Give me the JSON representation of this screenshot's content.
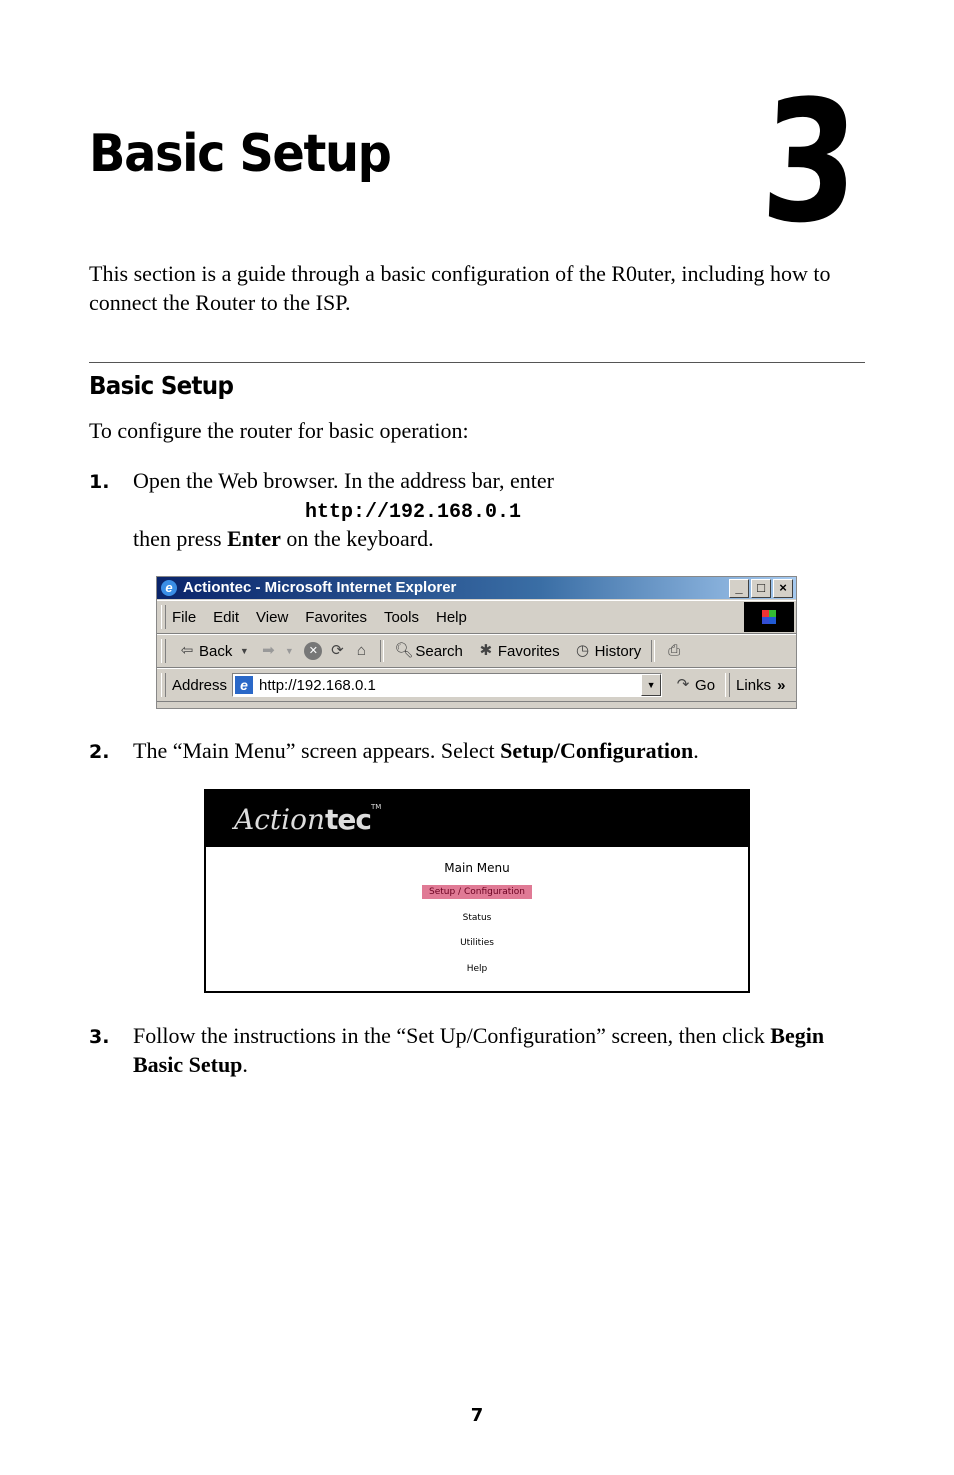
{
  "chapter": {
    "title": "Basic Setup",
    "number": "3"
  },
  "intro": "This section is a guide through a basic configuration of the R0uter, including how to connect the Router to the ISP.",
  "section": {
    "heading": "Basic Setup",
    "lead": "To configure the router for basic operation:",
    "steps": [
      {
        "num": "1.",
        "text_a": "Open the Web browser. In the address bar, enter",
        "code": "http://192.168.0.1",
        "text_b_pre": "then press ",
        "text_b_bold": "Enter",
        "text_b_post": " on the keyboard."
      },
      {
        "num": "2.",
        "text_pre": "The “Main Menu” screen appears. Select ",
        "text_bold": "Setup/Configuration",
        "text_post": "."
      },
      {
        "num": "3.",
        "text_pre": "Follow the instructions in the “Set Up/Configuration” screen, then click ",
        "text_bold": "Begin Basic Setup",
        "text_post": "."
      }
    ]
  },
  "browser": {
    "title": "Actiontec - Microsoft Internet Explorer",
    "window_buttons": [
      "_",
      "□",
      "×"
    ],
    "menu": [
      "File",
      "Edit",
      "View",
      "Favorites",
      "Tools",
      "Help"
    ],
    "toolbar": {
      "back": "Back",
      "search": "Search",
      "favorites": "Favorites",
      "history": "History"
    },
    "address_label": "Address",
    "address_value": "http://192.168.0.1",
    "go": "Go",
    "links": "Links",
    "links_more": "»"
  },
  "router_screen": {
    "logo_script": "Action",
    "logo_tec": "tec",
    "logo_tm": "TM",
    "title": "Main Menu",
    "items": [
      "Setup / Configuration",
      "Status",
      "Utilities",
      "Help"
    ],
    "selected_color": "#e07a95"
  },
  "page_number": "7"
}
